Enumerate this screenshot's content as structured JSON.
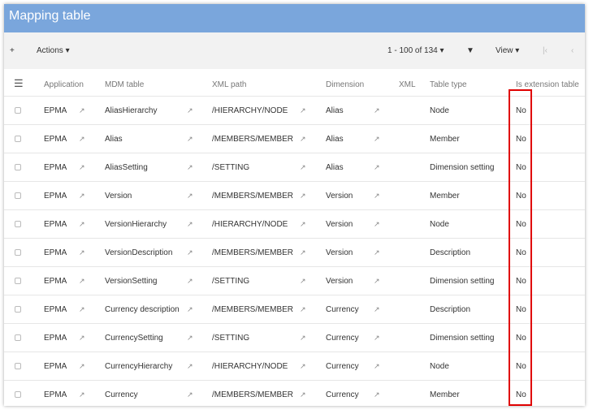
{
  "title": "Mapping table",
  "toolbar": {
    "add": "+",
    "actions": "Actions ▾",
    "pager": "1 - 100 of 134 ▾",
    "filter": "▼",
    "view": "View ▾",
    "first": "|‹",
    "prev": "‹"
  },
  "columns": [
    "Application",
    "MDM table",
    "XML path",
    "Dimension",
    "XML",
    "Table type",
    "Is extension table"
  ],
  "rows": [
    [
      "EPMA",
      "AliasHierarchy",
      "/HIERARCHY/NODE",
      "Alias",
      "",
      "Node",
      "No"
    ],
    [
      "EPMA",
      "Alias",
      "/MEMBERS/MEMBER",
      "Alias",
      "",
      "Member",
      "No"
    ],
    [
      "EPMA",
      "AliasSetting",
      "/SETTING",
      "Alias",
      "",
      "Dimension setting",
      "No"
    ],
    [
      "EPMA",
      "Version",
      "/MEMBERS/MEMBER",
      "Version",
      "",
      "Member",
      "No"
    ],
    [
      "EPMA",
      "VersionHierarchy",
      "/HIERARCHY/NODE",
      "Version",
      "",
      "Node",
      "No"
    ],
    [
      "EPMA",
      "VersionDescription",
      "/MEMBERS/MEMBER",
      "Version",
      "",
      "Description",
      "No"
    ],
    [
      "EPMA",
      "VersionSetting",
      "/SETTING",
      "Version",
      "",
      "Dimension setting",
      "No"
    ],
    [
      "EPMA",
      "Currency description",
      "/MEMBERS/MEMBER",
      "Currency",
      "",
      "Description",
      "No"
    ],
    [
      "EPMA",
      "CurrencySetting",
      "/SETTING",
      "Currency",
      "",
      "Dimension setting",
      "No"
    ],
    [
      "EPMA",
      "CurrencyHierarchy",
      "/HIERARCHY/NODE",
      "Currency",
      "",
      "Node",
      "No"
    ],
    [
      "EPMA",
      "Currency",
      "/MEMBERS/MEMBER",
      "Currency",
      "",
      "Member",
      "No"
    ]
  ],
  "highlight_color": "#e00000"
}
